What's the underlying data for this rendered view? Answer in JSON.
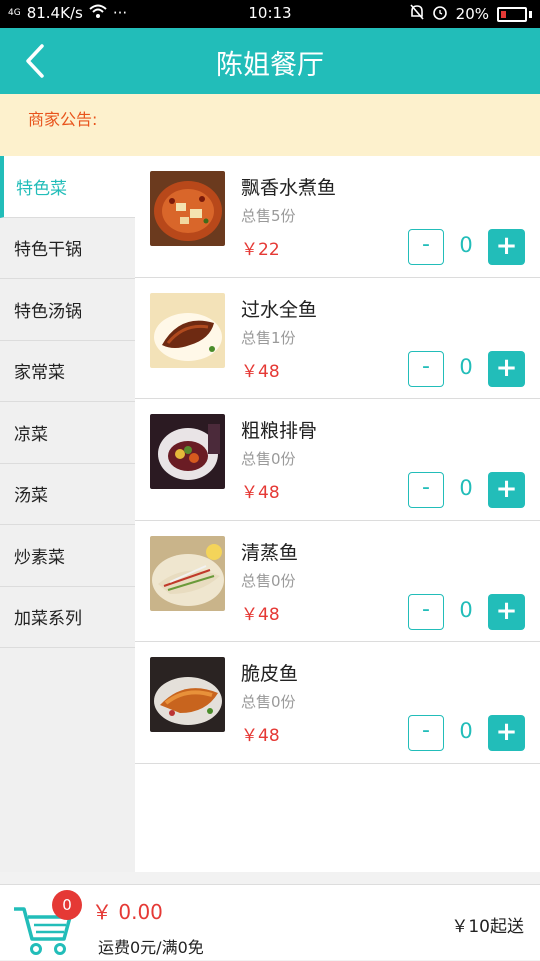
{
  "status_bar": {
    "network": "4G",
    "speed": "81.4K/s",
    "more": "···",
    "time": "10:13",
    "battery": "20%"
  },
  "header": {
    "title": "陈姐餐厅"
  },
  "notice": {
    "label": "商家公告:"
  },
  "categories": [
    {
      "label": "特色菜",
      "active": true
    },
    {
      "label": "特色干锅"
    },
    {
      "label": "特色汤锅"
    },
    {
      "label": "家常菜"
    },
    {
      "label": "凉菜"
    },
    {
      "label": "汤菜"
    },
    {
      "label": "炒素菜"
    },
    {
      "label": "加菜系列"
    }
  ],
  "dishes": [
    {
      "name": "飘香水煮鱼",
      "sold": "总售5份",
      "price": "￥22",
      "qty": "0",
      "minus": "-",
      "plus": "+"
    },
    {
      "name": "过水全鱼",
      "sold": "总售1份",
      "price": "￥48",
      "qty": "0",
      "minus": "-",
      "plus": "+"
    },
    {
      "name": "粗粮排骨",
      "sold": "总售0份",
      "price": "￥48",
      "qty": "0",
      "minus": "-",
      "plus": "+"
    },
    {
      "name": "清蒸鱼",
      "sold": "总售0份",
      "price": "￥48",
      "qty": "0",
      "minus": "-",
      "plus": "+"
    },
    {
      "name": "脆皮鱼",
      "sold": "总售0份",
      "price": "￥48",
      "qty": "0",
      "minus": "-",
      "plus": "+"
    }
  ],
  "cart": {
    "count": "0",
    "total": "￥ 0.00",
    "delivery_fee": "运费0元/满0免",
    "min_order": "￥10起送"
  },
  "colors": {
    "accent": "#22bdb9",
    "price": "#e53935",
    "notice_bg": "#fdf1cd",
    "notice_text": "#e8541c"
  }
}
